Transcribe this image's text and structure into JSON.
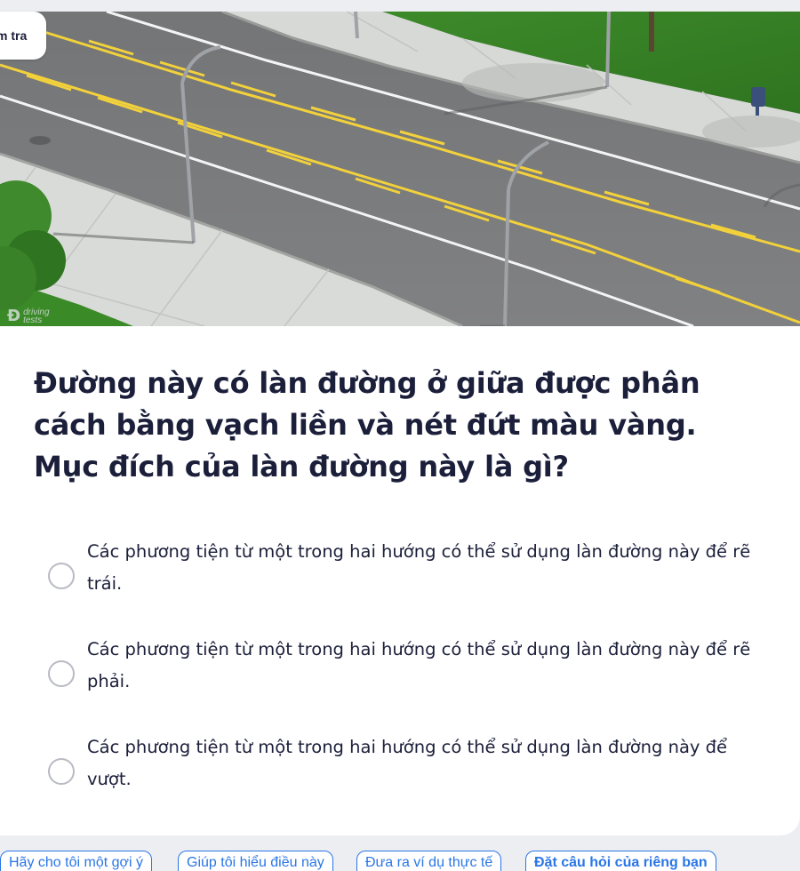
{
  "badge": {
    "label": "m tra"
  },
  "watermark": {
    "logo": "Ɖ",
    "line1": "driving",
    "line2": "tests"
  },
  "question": {
    "text": "Đường này có làn đường ở giữa được phân cách bằng vạch liền và nét đứt màu vàng. Mục đích của làn đường này là gì?"
  },
  "answers": [
    {
      "text": "Các phương tiện từ một trong hai hướng có thể sử dụng làn đường này để rẽ trái.",
      "selected": false
    },
    {
      "text": "Các phương tiện từ một trong hai hướng có thể sử dụng làn đường này để rẽ phải.",
      "selected": false
    },
    {
      "text": "Các phương tiện từ một trong hai hướng có thể sử dụng làn đường này để vượt.",
      "selected": false
    }
  ],
  "chips": [
    {
      "label": "Hãy cho tôi một gợi ý"
    },
    {
      "label": "Giúp tôi hiểu điều này"
    },
    {
      "label": "Đưa ra ví dụ thực tế"
    },
    {
      "label": "Đặt câu hỏi của riêng bạn"
    }
  ],
  "colors": {
    "accent": "#2a76e6",
    "text": "#1b1f3a",
    "radio_border": "#b9bbc3",
    "page_bg": "#edeef2",
    "road": "#7a7b7d",
    "lane_yellow": "#f2d13b"
  },
  "icons": {
    "answer_radio": "radio-unchecked-icon"
  }
}
